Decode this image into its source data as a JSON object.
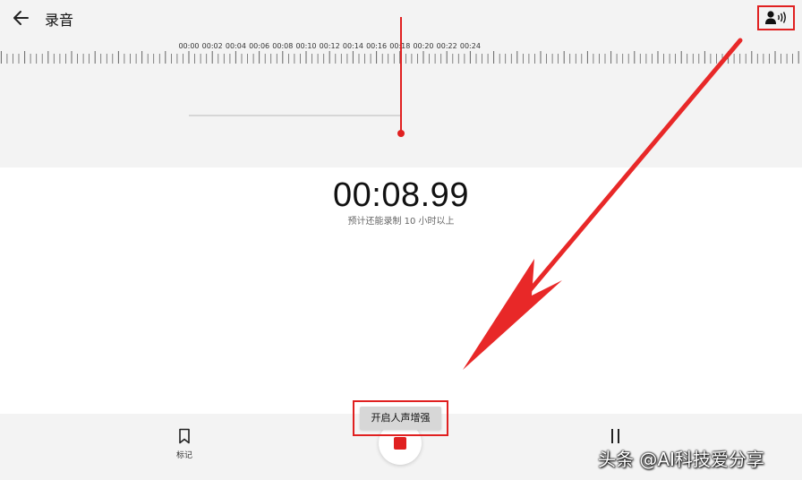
{
  "header": {
    "title": "录音",
    "back_icon": "arrow-left-icon",
    "voice_enhance_icon": "person-voice-icon"
  },
  "timeline": {
    "tick_labels": [
      "00:00",
      "00:02",
      "00:04",
      "00:06",
      "00:08",
      "00:10",
      "00:12",
      "00:14",
      "00:16",
      "00:18",
      "00:20",
      "00:22",
      "00:24"
    ]
  },
  "recording": {
    "elapsed": "00:08.99",
    "remaining_hint": "预计还能录制 10 小时以上"
  },
  "controls": {
    "mark_label": "标记",
    "mark_icon": "bookmark-icon",
    "record_icon": "stop-icon",
    "pause_icon": "pause-icon",
    "tooltip": "开启人声增强"
  },
  "watermark": "头条 @AI科技爱分享",
  "colors": {
    "accent": "#e02020",
    "header_bg": "#f3f3f3",
    "page_bg": "#ffffff"
  }
}
